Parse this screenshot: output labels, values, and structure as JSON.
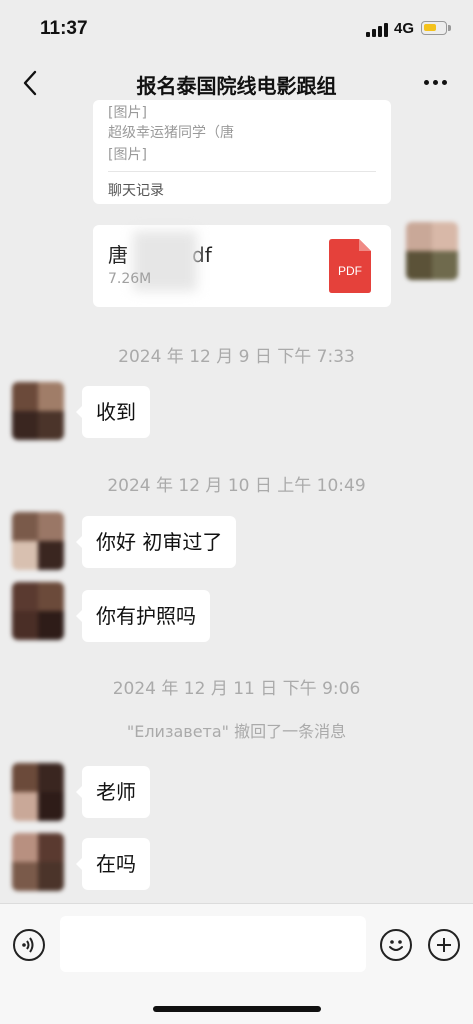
{
  "status": {
    "time": "11:37",
    "network": "4G"
  },
  "header": {
    "title": "报名泰国院线电影跟组"
  },
  "forward_card": {
    "lines": [
      "[图片]",
      "超级幸运猪同学（唐",
      "[图片]"
    ],
    "footer": "聊天记录"
  },
  "file_card": {
    "name_start": "唐",
    "name_end": "df",
    "size": "7.26M",
    "icon_label": "PDF"
  },
  "messages": {
    "ts1": "2024 年 12 月 9 日  下午 7:33",
    "m1": "收到",
    "ts2": "2024 年 12 月 10 日  上午 10:49",
    "m2": "你好 初审过了",
    "m3": "你有护照吗",
    "ts3": "2024 年 12 月 11 日  下午 9:06",
    "recall": "\"Елизавета\" 撤回了一条消息",
    "m4": "老师",
    "m5": "在吗"
  },
  "colors": {
    "background": "#ededed",
    "bubble": "#ffffff",
    "pdf": "#e5413b",
    "battery": "#f4c21c"
  },
  "icons": [
    "back-arrow-icon",
    "more-icon",
    "voice-icon",
    "emoji-icon",
    "plus-icon",
    "pdf-file-icon"
  ]
}
